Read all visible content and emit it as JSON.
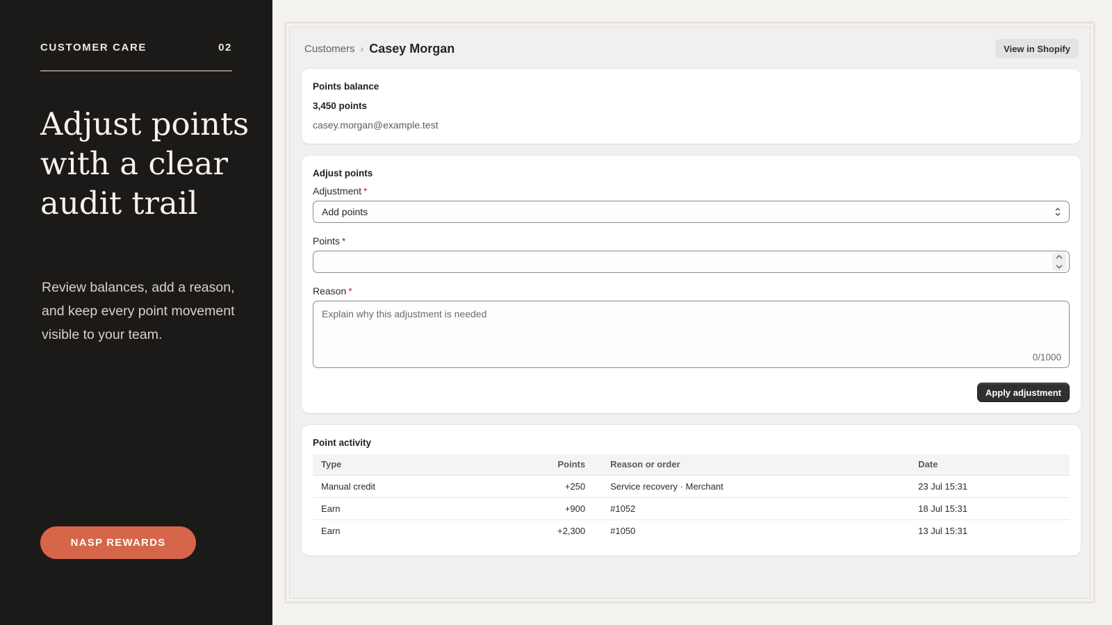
{
  "side": {
    "eyebrow": "CUSTOMER CARE",
    "step": "02",
    "headline": "Adjust points with a clear audit trail",
    "lede": "Review balances, add a reason, and keep every point movement visible to your team.",
    "pill_label": "NASP REWARDS"
  },
  "header": {
    "breadcrumb_parent": "Customers",
    "breadcrumb_sep": "›",
    "customer_name": "Casey Morgan",
    "view_button": "View in Shopify"
  },
  "balance": {
    "title": "Points balance",
    "points": "3,450 points",
    "email": "casey.morgan@example.test"
  },
  "adjust": {
    "title": "Adjust points",
    "adjustment_label": "Adjustment",
    "adjustment_value": "Add points",
    "points_label": "Points",
    "points_value": "",
    "reason_label": "Reason",
    "reason_placeholder": "Explain why this adjustment is needed",
    "reason_counter": "0/1000",
    "required_mark": "*",
    "apply_button": "Apply adjustment"
  },
  "activity": {
    "title": "Point activity",
    "columns": [
      "Type",
      "Points",
      "Reason or order",
      "Date"
    ],
    "rows": [
      {
        "type": "Manual credit",
        "points": "+250",
        "reason": "Service recovery · Merchant",
        "date": "23 Jul 15:31"
      },
      {
        "type": "Earn",
        "points": "+900",
        "reason": "#1052",
        "date": "18 Jul 15:31"
      },
      {
        "type": "Earn",
        "points": "+2,300",
        "reason": "#1050",
        "date": "13 Jul 15:31"
      }
    ]
  },
  "colors": {
    "sidebar_bg": "#1c1a18",
    "accent": "#d6664a",
    "primary_button": "#303030",
    "required": "#b0282b"
  }
}
